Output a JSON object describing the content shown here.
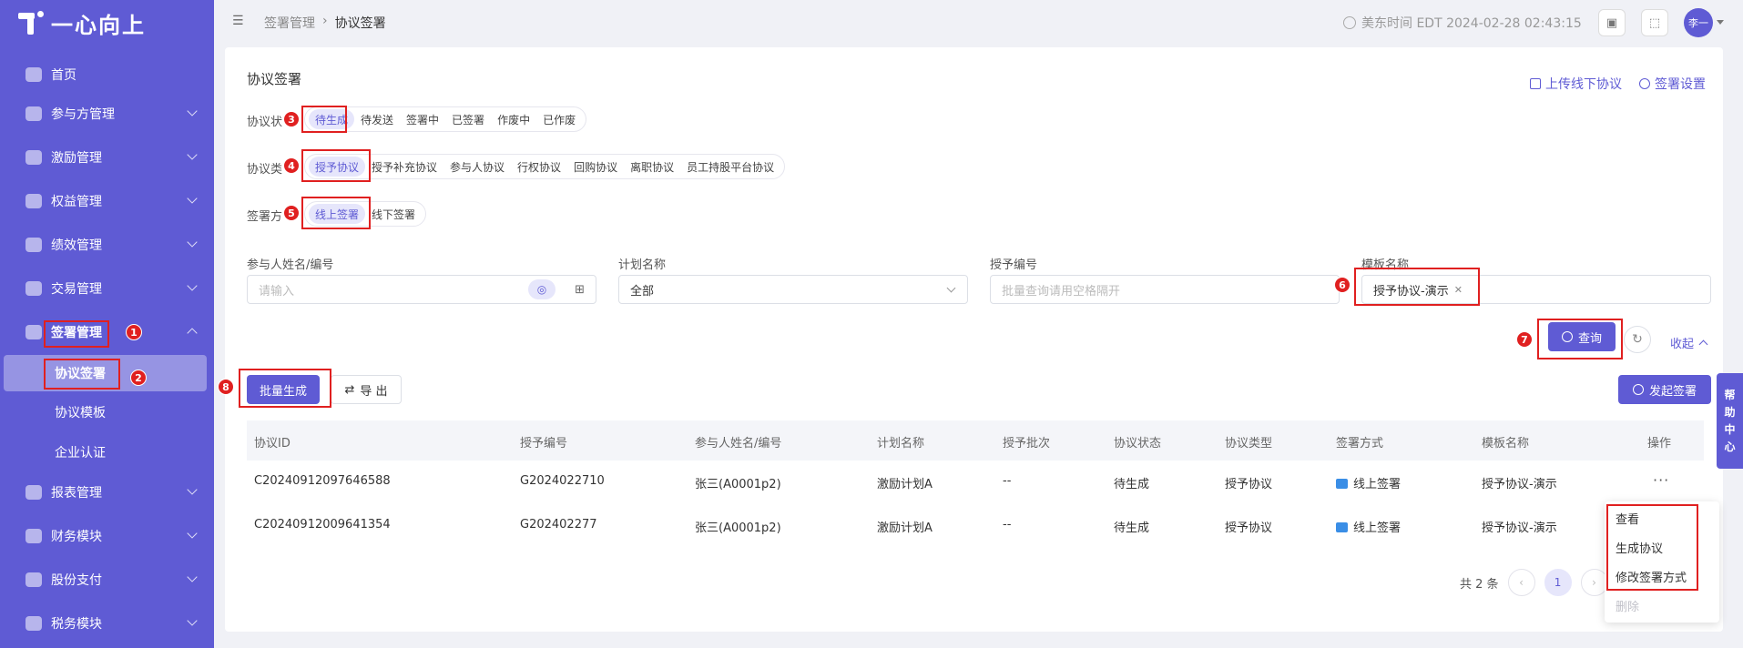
{
  "app": {
    "brand": "一心向上"
  },
  "sidebar": {
    "items": [
      {
        "label": "首页",
        "icon": "home-icon"
      },
      {
        "label": "参与方管理",
        "icon": "users-icon"
      },
      {
        "label": "激励管理",
        "icon": "incentive-icon"
      },
      {
        "label": "权益管理",
        "icon": "equity-icon"
      },
      {
        "label": "绩效管理",
        "icon": "performance-icon"
      },
      {
        "label": "交易管理",
        "icon": "trade-icon"
      },
      {
        "label": "签署管理",
        "icon": "sign-icon"
      },
      {
        "label": "报表管理",
        "icon": "report-icon"
      },
      {
        "label": "财务模块",
        "icon": "finance-icon"
      },
      {
        "label": "股份支付",
        "icon": "share-pay-icon"
      },
      {
        "label": "税务模块",
        "icon": "tax-icon"
      }
    ],
    "sub_items": [
      {
        "label": "协议签署"
      },
      {
        "label": "协议模板"
      },
      {
        "label": "企业认证"
      }
    ]
  },
  "header": {
    "breadcrumb": [
      "签署管理",
      "协议签署"
    ],
    "time": "美东时间 EDT 2024-02-28 02:43:15",
    "avatar": "李一"
  },
  "annotations": [
    "1",
    "2",
    "3",
    "4",
    "5",
    "6",
    "7",
    "8"
  ],
  "main": {
    "title": "协议签署",
    "upload_link": "上传线下协议",
    "settings_link": "签署设置",
    "filters": {
      "status": {
        "label": "协议状",
        "options": [
          "待生成",
          "待发送",
          "签署中",
          "已签署",
          "作废中",
          "已作废"
        ],
        "selected": 0
      },
      "type": {
        "label": "协议类",
        "options": [
          "授予协议",
          "授予补充协议",
          "参与人协议",
          "行权协议",
          "回购协议",
          "离职协议",
          "员工持股平台协议"
        ],
        "selected": 0
      },
      "method": {
        "label": "签署方",
        "options": [
          "线上签署",
          "线下签署"
        ],
        "selected": 0
      }
    },
    "fields": {
      "participant": {
        "label": "参与人姓名/编号",
        "placeholder": "请输入"
      },
      "plan": {
        "label": "计划名称",
        "value": "全部"
      },
      "grant": {
        "label": "授予编号",
        "placeholder": "批量查询请用空格隔开"
      },
      "template": {
        "label": "模板名称",
        "tag": "授予协议-演示"
      }
    },
    "query_button": "查询",
    "collapse_label": "收起",
    "batch_button": "批量生成",
    "export_button": "导 出",
    "initiate_button": "发起签署"
  },
  "table": {
    "columns": [
      "协议ID",
      "授予编号",
      "参与人姓名/编号",
      "计划名称",
      "授予批次",
      "协议状态",
      "协议类型",
      "签署方式",
      "模板名称",
      "操作"
    ],
    "rows": [
      [
        "C20240912097646588",
        "G2024022710",
        "张三(A0001p2)",
        "激励计划A",
        "--",
        "待生成",
        "授予协议",
        "线上签署",
        "授予协议-演示"
      ],
      [
        "C20240912009641354",
        "G202402277",
        "张三(A0001p2)",
        "激励计划A",
        "--",
        "待生成",
        "授予协议",
        "线上签署",
        "授予协议-演示"
      ]
    ]
  },
  "pagination": {
    "total": "共 2 条",
    "current": "1"
  },
  "dropdown": [
    "查看",
    "生成协议",
    "修改签署方式",
    "删除"
  ],
  "help": [
    "帮",
    "助",
    "中",
    "心"
  ],
  "colors": {
    "primary": "#5f5bd4",
    "annotation": "#e02020"
  }
}
